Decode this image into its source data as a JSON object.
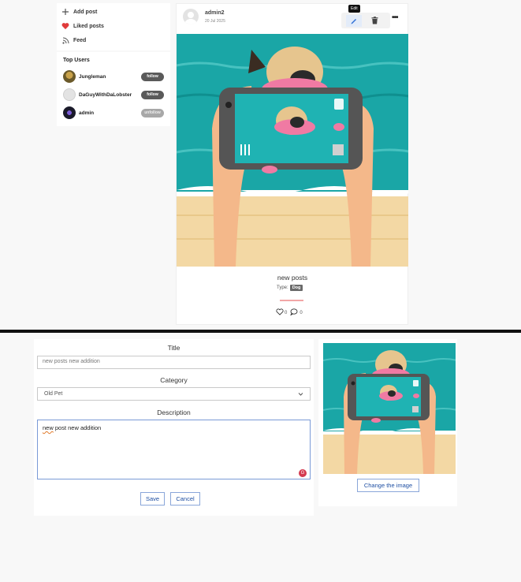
{
  "sidebar": {
    "items": [
      {
        "label": "Add post",
        "icon": "plus-icon"
      },
      {
        "label": "Liked posts",
        "icon": "heart-icon"
      },
      {
        "label": "Feed",
        "icon": "rss-icon"
      }
    ]
  },
  "top_users": {
    "title": "Top Users",
    "users": [
      {
        "name": "Jungleman",
        "button": "follow"
      },
      {
        "name": "DaGuyWithDaLobster",
        "button": "follow"
      },
      {
        "name": "admin",
        "button": "unfollow"
      }
    ]
  },
  "post": {
    "author": "admin2",
    "date": "20 Jul 2025",
    "edit_tooltip": "Edit",
    "title": "new posts",
    "type_label": "Type:",
    "type_value": "Dog",
    "likes": "0",
    "comments": "0"
  },
  "edit_form": {
    "title_label": "Title",
    "title_value": "new posts new addition",
    "category_label": "Category",
    "category_value": "Old Pet",
    "description_label": "Description",
    "description_word1": "new",
    "description_rest": " post new addition",
    "save_label": "Save",
    "cancel_label": "Cancel"
  },
  "preview": {
    "change_label": "Change the image"
  },
  "colors": {
    "sea": "#1aa6a6",
    "sand": "#f3d8a4",
    "skin": "#f4b88a",
    "accent_blue": "#1f4fa3",
    "heart_red": "#e03b3b"
  }
}
